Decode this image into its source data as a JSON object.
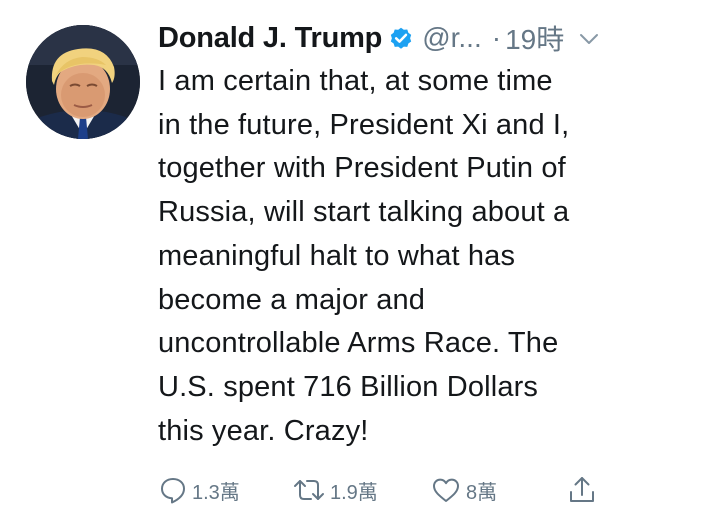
{
  "tweet": {
    "display_name": "Donald J. Trump",
    "handle": "@r...",
    "separator": "·",
    "time": "19時",
    "body": "I am certain that, at some time\nin the future, President Xi and I,\ntogether with President Putin of\nRussia, will start talking about a\nmeaningful halt to what has\nbecome a major and\nuncontrollable Arms Race. The\nU.S. spent 716 Billion Dollars\nthis year. Crazy!",
    "actions": {
      "reply_count": "1.3萬",
      "retweet_count": "1.9萬",
      "like_count": "8萬"
    }
  },
  "icons": {
    "verified": "verified-badge-icon",
    "caret": "chevron-down-icon",
    "reply": "reply-icon",
    "retweet": "retweet-icon",
    "like": "heart-icon",
    "share": "share-icon"
  },
  "colors": {
    "text": "#14171a",
    "secondary": "#657786",
    "verified": "#1da1f2",
    "background": "#ffffff"
  }
}
